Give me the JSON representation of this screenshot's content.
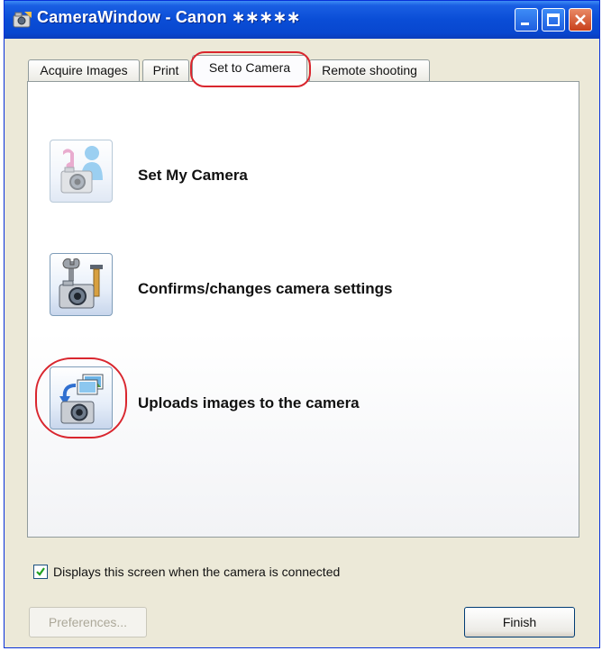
{
  "window": {
    "title": "CameraWindow - Canon ∗∗∗∗∗"
  },
  "tabs": [
    {
      "label": "Acquire Images"
    },
    {
      "label": "Print"
    },
    {
      "label": "Set to Camera",
      "active": true
    },
    {
      "label": "Remote shooting"
    }
  ],
  "actions": [
    {
      "label": "Set My Camera",
      "icon": "set-my-camera-icon"
    },
    {
      "label": "Confirms/changes camera settings",
      "icon": "camera-settings-icon"
    },
    {
      "label": "Uploads images to the camera",
      "icon": "upload-images-icon"
    }
  ],
  "footer": {
    "checkbox_label": "Displays this screen when the camera is connected",
    "checkbox_checked": true,
    "preferences_label": "Preferences...",
    "finish_label": "Finish"
  },
  "colors": {
    "titlebar": "#0a4dd6",
    "highlight": "#d9262e",
    "window_face": "#ece9d8"
  }
}
